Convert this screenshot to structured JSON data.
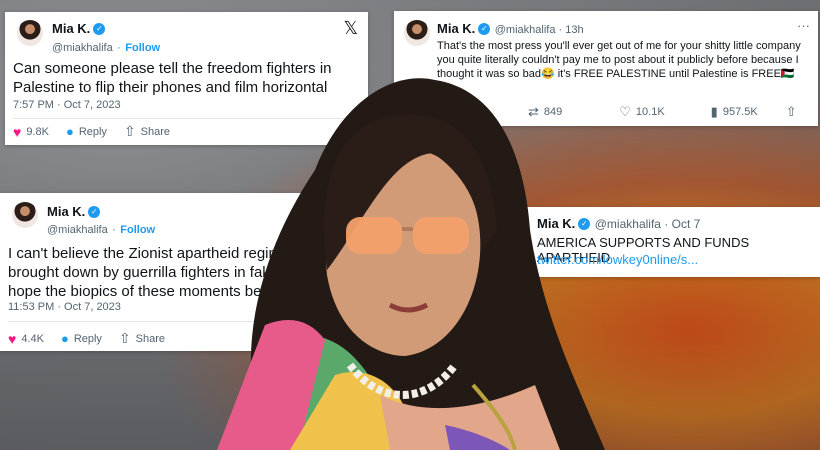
{
  "tweet1": {
    "name": "Mia K.",
    "handle": "@miakhalifa",
    "follow": "Follow",
    "text": "Can someone please tell the freedom fighters in Palestine to flip their phones and film horizontal",
    "time": "7:57 PM · Oct 7, 2023",
    "likes": "9.8K",
    "reply": "Reply",
    "share": "Share",
    "x": "𝕏"
  },
  "tweet2": {
    "name": "Mia K.",
    "handle": "@miakhalifa · 13h",
    "text": "That's the most press you'll ever get out of me for your shitty little company you quite literally couldn't pay me to post about it publicly before because I thought it was so bad😂 it's FREE PALESTINE until Palestine is FREE🇵🇸",
    "retweets": "849",
    "likes": "10.1K",
    "views": "957.5K",
    "more": "···"
  },
  "tweet3": {
    "name": "Mia K.",
    "handle": "@miakhalifa",
    "follow": "Follow",
    "text": "I can't believe the Zionist apartheid regime is being brought down by guerrilla fighters in fake Crocs, I hope the biopics of these moments better reflect",
    "time": "11:53 PM · Oct 7, 2023",
    "likes": "4.4K",
    "reply": "Reply",
    "share": "Share"
  },
  "tweet4": {
    "name": "Mia K.",
    "handle": "@miakhalifa · Oct 7",
    "text": "AMERICA SUPPORTS AND FUNDS APARTHEID",
    "link": "twitter.com/lowkey0nline/s..."
  },
  "colors": {
    "accent": "#1d9bf0",
    "like": "#f91880"
  },
  "icons": [
    "x-logo-icon",
    "verified-badge-icon",
    "heart-icon",
    "reply-icon",
    "share-icon",
    "retweet-icon",
    "views-icon",
    "more-icon"
  ]
}
